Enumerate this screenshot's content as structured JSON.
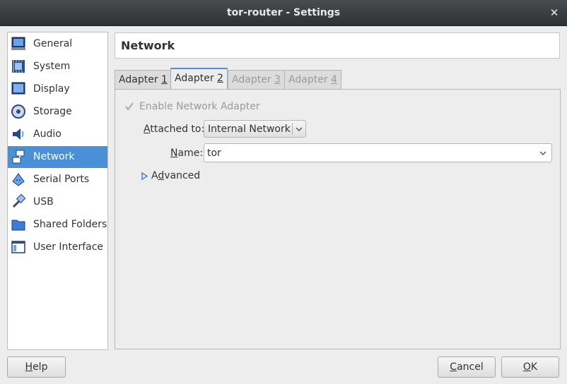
{
  "window": {
    "title": "tor-router - Settings",
    "close_glyph": "✕"
  },
  "sidebar": {
    "items": [
      {
        "label": "General",
        "icon": "monitor-icon"
      },
      {
        "label": "System",
        "icon": "chip-icon"
      },
      {
        "label": "Display",
        "icon": "display-icon"
      },
      {
        "label": "Storage",
        "icon": "disk-icon"
      },
      {
        "label": "Audio",
        "icon": "speaker-icon"
      },
      {
        "label": "Network",
        "icon": "network-icon",
        "selected": true
      },
      {
        "label": "Serial Ports",
        "icon": "serial-port-icon"
      },
      {
        "label": "USB",
        "icon": "usb-icon"
      },
      {
        "label": "Shared Folders",
        "icon": "folder-icon"
      },
      {
        "label": "User Interface",
        "icon": "window-icon"
      }
    ]
  },
  "header": {
    "title": "Network"
  },
  "tabs": [
    {
      "label": "Adapter ",
      "mnemonic": "1",
      "state": "normal"
    },
    {
      "label": "Adapter ",
      "mnemonic": "2",
      "state": "active"
    },
    {
      "label": "Adapter ",
      "mnemonic": "3",
      "state": "disabled"
    },
    {
      "label": "Adapter ",
      "mnemonic": "4",
      "state": "disabled"
    }
  ],
  "adapter": {
    "enable_label": "Enable Network Adapter",
    "enabled": true,
    "attached_to_mnemonic": "A",
    "attached_to_rest": "ttached to:",
    "attached_to_value": "Internal Network",
    "name_mnemonic": "N",
    "name_rest": "ame:",
    "name_value": "tor",
    "advanced_pre": "A",
    "advanced_mnemonic": "d",
    "advanced_rest": "vanced"
  },
  "buttons": {
    "help_mnemonic": "H",
    "help_rest": "elp",
    "cancel_mnemonic": "C",
    "cancel_rest": "ancel",
    "ok_mnemonic": "O",
    "ok_rest": "K"
  },
  "colors": {
    "accent": "#4a90d9",
    "titlebar": "#3a3d3f"
  }
}
